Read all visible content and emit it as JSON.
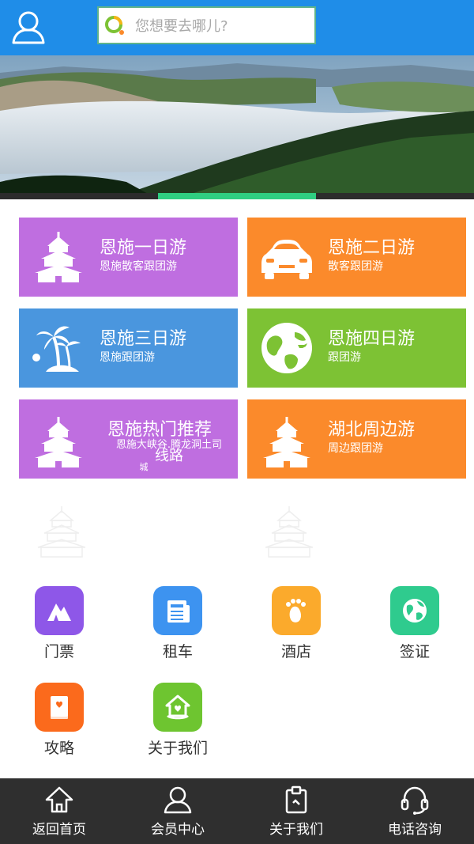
{
  "colors": {
    "header": "#1f8de8",
    "purple": "#bf6ee0",
    "orange": "#fb8a2b",
    "blue": "#4a96de",
    "green": "#7dc234",
    "indicator_active": "#2fce81",
    "bottom_bar": "#2f2f2f"
  },
  "search": {
    "placeholder": "您想要去哪儿?"
  },
  "banner": {
    "slide_count": 3,
    "active_index": 1
  },
  "tiles": [
    {
      "title": "恩施一日游",
      "subtitle": "恩施散客跟团游",
      "icon": "pagoda-icon"
    },
    {
      "title": "恩施二日游",
      "subtitle": "散客跟团游",
      "icon": "car-icon"
    },
    {
      "title": "恩施三日游",
      "subtitle": "恩施跟团游",
      "icon": "palm-tree-icon"
    },
    {
      "title": "恩施四日游",
      "subtitle": "跟团游",
      "icon": "globe-icon"
    },
    {
      "title": "恩施热门推荐",
      "subtitle_line1": "恩施大峡谷.腾龙洞土司",
      "subtitle_line2": "线路",
      "subtitle_line3": "城",
      "icon": "pagoda-icon"
    },
    {
      "title": "湖北周边游",
      "subtitle": "周边跟团游",
      "icon": "pagoda-icon"
    }
  ],
  "quick": [
    {
      "label": "门票",
      "icon": "mountain-ticket-icon",
      "color": "#8e57e8"
    },
    {
      "label": "租车",
      "icon": "newspaper-icon",
      "color": "#3d93f0"
    },
    {
      "label": "酒店",
      "icon": "footprint-icon",
      "color": "#fbaa2c"
    },
    {
      "label": "签证",
      "icon": "globe-icon",
      "color": "#2fcb8e"
    },
    {
      "label": "攻略",
      "icon": "book-icon",
      "color": "#fb6a1c"
    },
    {
      "label": "关于我们",
      "icon": "heart-home-icon",
      "color": "#6ec530"
    }
  ],
  "bottom_nav": [
    {
      "label": "返回首页",
      "icon": "home-icon"
    },
    {
      "label": "会员中心",
      "icon": "user-icon"
    },
    {
      "label": "关于我们",
      "icon": "clipboard-icon"
    },
    {
      "label": "电话咨询",
      "icon": "headset-icon"
    }
  ]
}
